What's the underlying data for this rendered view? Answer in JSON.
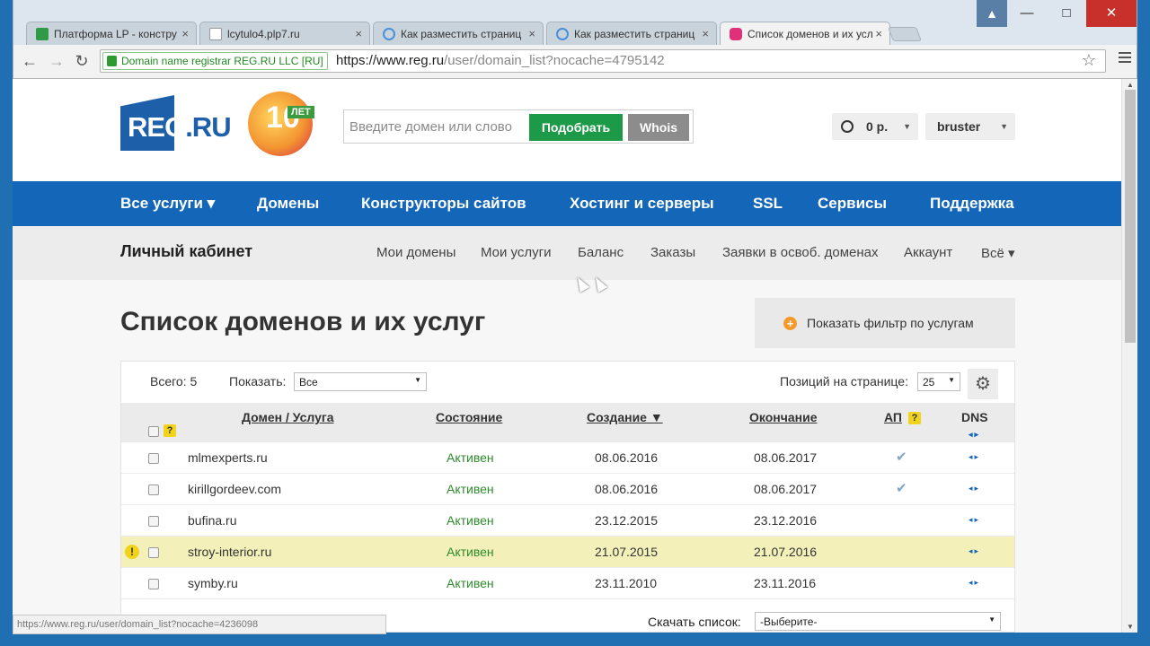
{
  "browser": {
    "tabs": [
      {
        "title": "Платформа LP - констру",
        "favicon_color": "#2f9b46"
      },
      {
        "title": "lcytulo4.plp7.ru",
        "favicon_color": "#ffffff"
      },
      {
        "title": "Как разместить страниц",
        "favicon_color": "#4a90d9"
      },
      {
        "title": "Как разместить страниц",
        "favicon_color": "#4a90d9"
      },
      {
        "title": "Список доменов и их усл",
        "favicon_color": "#e0307a"
      }
    ],
    "ev_badge": "Domain name registrar REG.RU LLC [RU]",
    "url_host": "https://www.reg.ru",
    "url_path": "/user/domain_list?nocache=4795142",
    "status_url": "https://www.reg.ru/user/domain_list?nocache=4236098"
  },
  "header": {
    "logo_left": "REG",
    "logo_right": ".RU",
    "anniv_number": "10",
    "anniv_label": "ЛЕТ",
    "search_placeholder": "Введите домен или слово",
    "pick_button": "Подобрать",
    "whois_button": "Whois",
    "balance": "0 р.",
    "username": "bruster"
  },
  "mainnav": {
    "items": [
      "Все услуги ▾",
      "Домены",
      "Конструкторы сайтов",
      "Хостинг и серверы",
      "SSL",
      "Сервисы",
      "Поддержка"
    ]
  },
  "subnav": {
    "title": "Личный кабинет",
    "links": [
      "Мои домены",
      "Мои услуги",
      "Баланс",
      "Заказы",
      "Заявки в освоб. доменах",
      "Аккаунт",
      "Всё ▾"
    ]
  },
  "page": {
    "title": "Список доменов и их услуг",
    "filter_button": "Показать фильтр по услугам",
    "total_label": "Всего: 5",
    "show_label": "Показать:",
    "show_value": "Все",
    "per_page_label": "Позиций на странице:",
    "per_page_value": "25",
    "download_label": "Скачать список:",
    "download_value": "-Выберите-"
  },
  "table": {
    "headers": {
      "domain": "Домен / Услуга",
      "state": "Состояние",
      "created": "Создание ▼",
      "expires": "Окончание",
      "ap": "АП",
      "dns": "DNS",
      "help": "?"
    },
    "rows": [
      {
        "domain": "mlmexperts.ru",
        "state": "Активен",
        "created": "08.06.2016",
        "expires": "08.06.2017",
        "ap": "✔",
        "dns": "◂▸",
        "warn": false
      },
      {
        "domain": "kirillgordeev.com",
        "state": "Активен",
        "created": "08.06.2016",
        "expires": "08.06.2017",
        "ap": "✔",
        "dns": "◂▸",
        "warn": false
      },
      {
        "domain": "bufina.ru",
        "state": "Активен",
        "created": "23.12.2015",
        "expires": "23.12.2016",
        "ap": "",
        "dns": "◂▸",
        "warn": false
      },
      {
        "domain": "stroy-interior.ru",
        "state": "Активен",
        "created": "21.07.2015",
        "expires": "21.07.2016",
        "ap": "",
        "dns": "◂▸",
        "warn": true
      },
      {
        "domain": "symby.ru",
        "state": "Активен",
        "created": "23.11.2010",
        "expires": "23.11.2016",
        "ap": "",
        "dns": "◂▸",
        "warn": false
      }
    ]
  },
  "icons": {
    "back": "←",
    "forward": "→",
    "reload": "↻",
    "star": "☆",
    "gear": "⚙",
    "plus": "+",
    "close": "×",
    "exclamation": "!"
  }
}
